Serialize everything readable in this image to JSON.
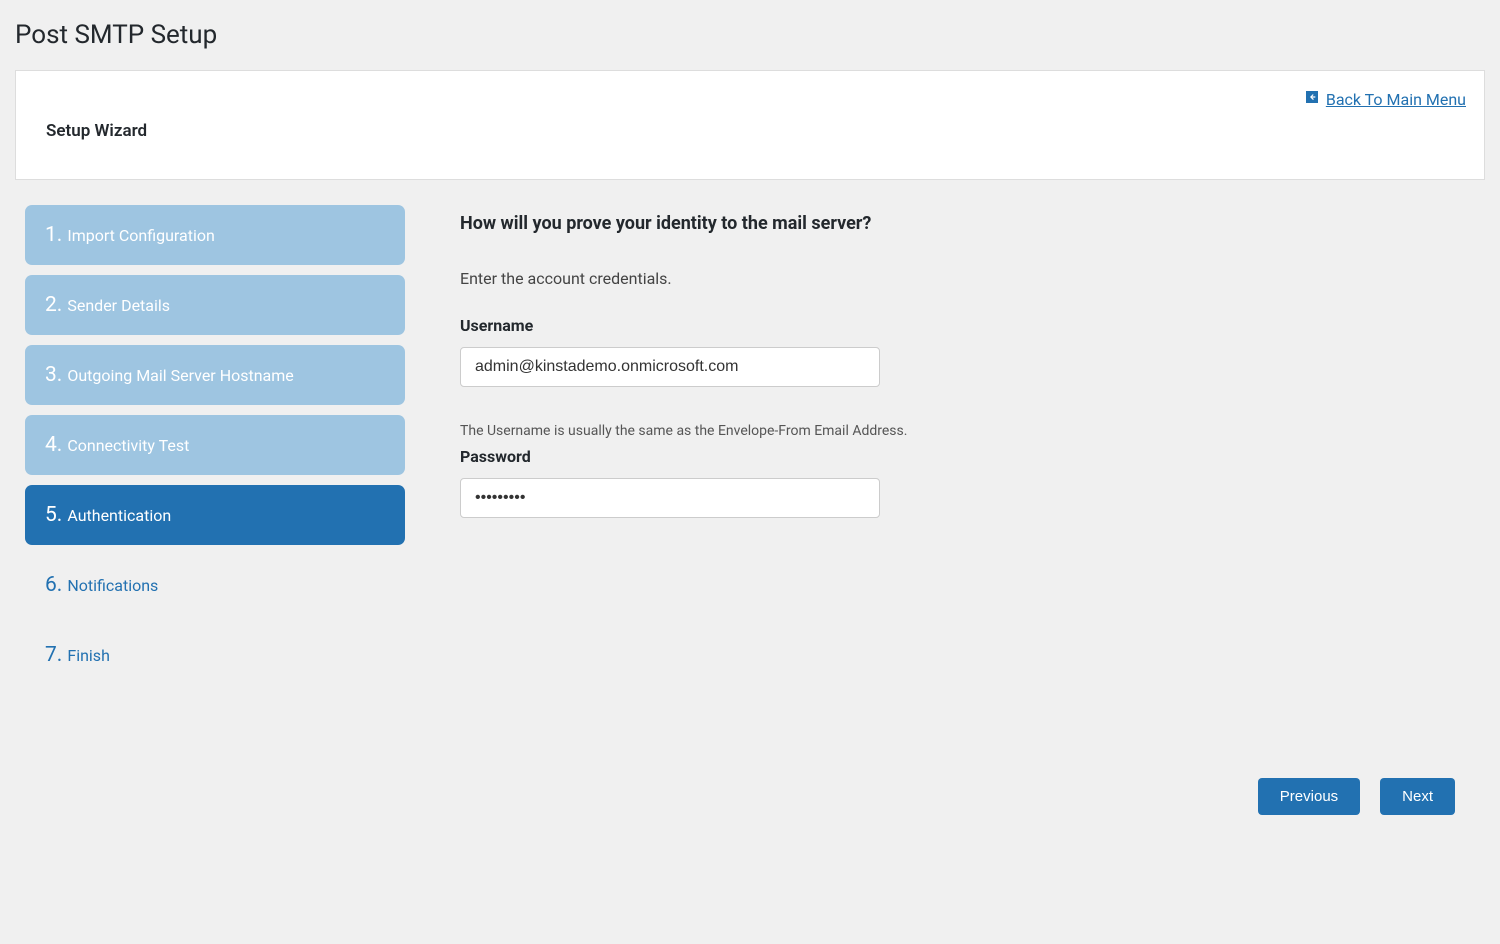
{
  "page": {
    "title": "Post SMTP Setup"
  },
  "header": {
    "wizard_title": "Setup Wizard",
    "back_link_label": "Back To Main Menu"
  },
  "sidebar": {
    "steps": [
      {
        "num": "1.",
        "label": "Import Configuration",
        "state": "past"
      },
      {
        "num": "2.",
        "label": "Sender Details",
        "state": "past"
      },
      {
        "num": "3.",
        "label": "Outgoing Mail Server Hostname",
        "state": "past"
      },
      {
        "num": "4.",
        "label": "Connectivity Test",
        "state": "past"
      },
      {
        "num": "5.",
        "label": "Authentication",
        "state": "active"
      },
      {
        "num": "6.",
        "label": "Notifications",
        "state": "future"
      },
      {
        "num": "7.",
        "label": "Finish",
        "state": "future"
      }
    ]
  },
  "content": {
    "heading": "How will you prove your identity to the mail server?",
    "intro": "Enter the account credentials.",
    "username_label": "Username",
    "username_value": "admin@kinstademo.onmicrosoft.com",
    "username_help": "The Username is usually the same as the Envelope-From Email Address.",
    "password_label": "Password",
    "password_value": "•••••••••"
  },
  "buttons": {
    "previous": "Previous",
    "next": "Next"
  }
}
